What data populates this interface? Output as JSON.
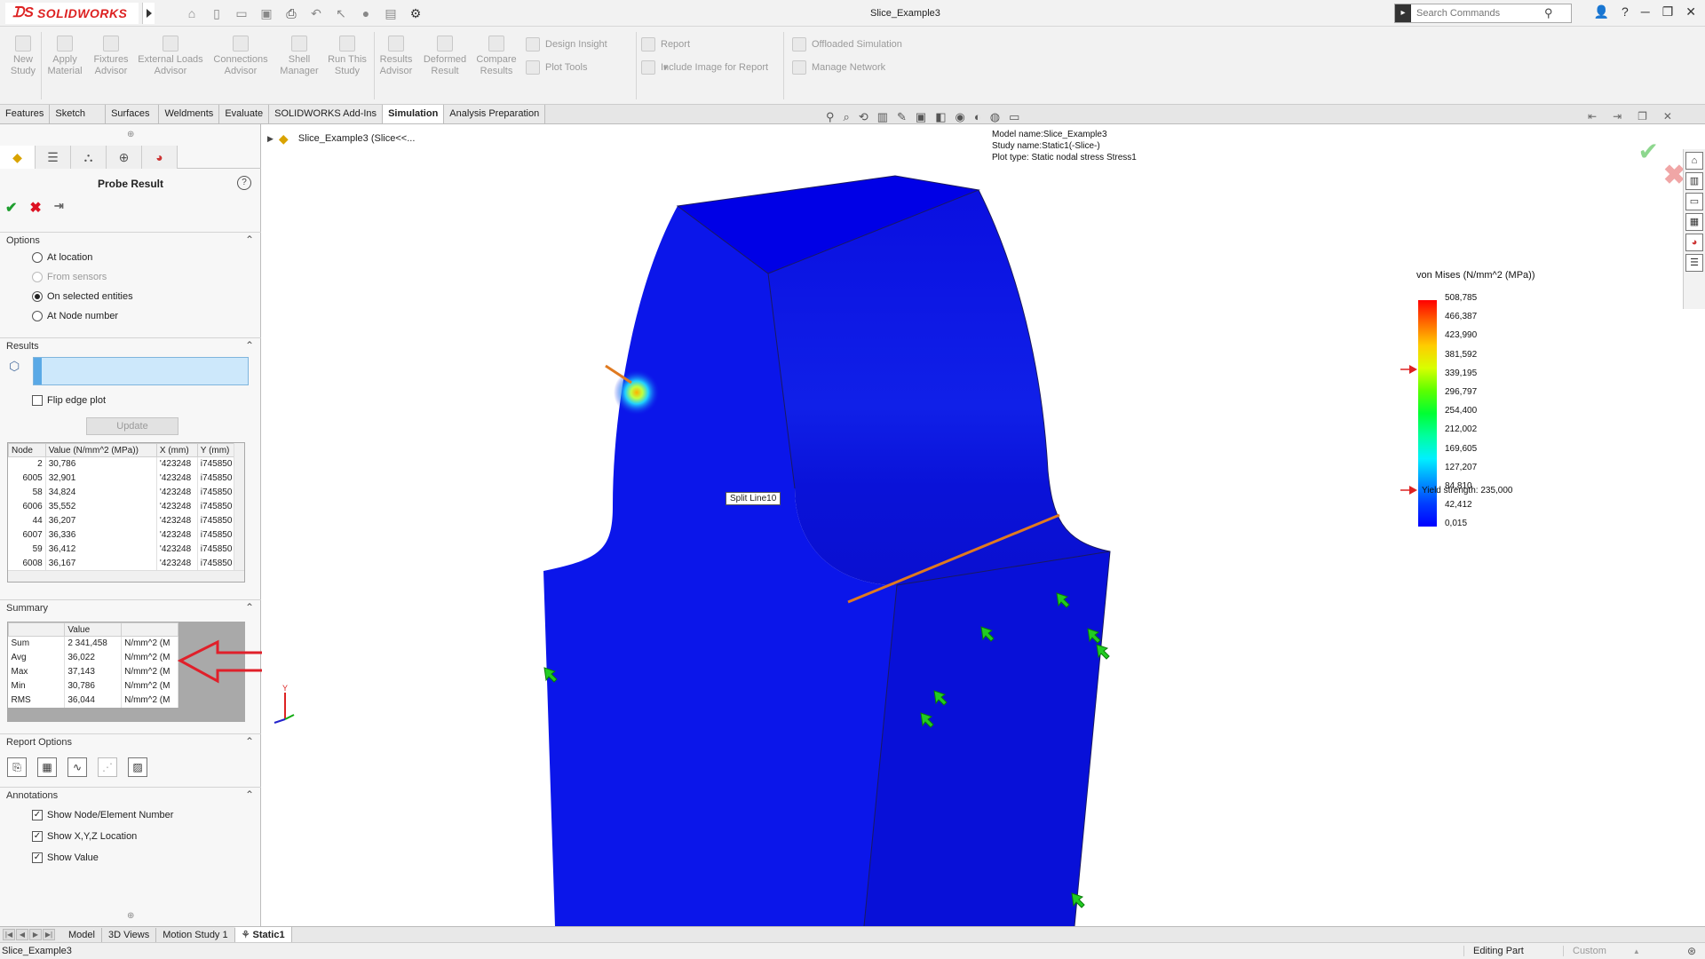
{
  "app": {
    "brand": "SOLIDWORKS",
    "doc_title": "Slice_Example3",
    "search_placeholder": "Search Commands"
  },
  "command_manager": {
    "large": [
      {
        "label": "New\nStudy"
      },
      {
        "label": "Apply\nMaterial"
      },
      {
        "label": "Fixtures\nAdvisor"
      },
      {
        "label": "External Loads\nAdvisor"
      },
      {
        "label": "Connections\nAdvisor"
      },
      {
        "label": "Shell\nManager"
      },
      {
        "label": "Run This\nStudy"
      },
      {
        "label": "Results\nAdvisor"
      },
      {
        "label": "Deformed\nResult"
      },
      {
        "label": "Compare\nResults"
      }
    ],
    "small": [
      "Design Insight",
      "Plot Tools",
      "Report",
      "Include Image for Report",
      "Offloaded Simulation",
      "Manage Network"
    ]
  },
  "tabs": [
    "Features",
    "Sketch",
    "Surfaces",
    "Weldments",
    "Evaluate",
    "SOLIDWORKS Add-Ins",
    "Simulation",
    "Analysis Preparation"
  ],
  "active_tab": "Simulation",
  "property_manager": {
    "title": "Probe Result",
    "options": {
      "header": "Options",
      "items": [
        "At location",
        "From sensors",
        "On selected entities",
        "At Node number"
      ],
      "selected": "On selected entities"
    },
    "results": {
      "header": "Results",
      "flip_edge_plot": "Flip edge plot",
      "update": "Update",
      "columns": [
        "Node",
        "Value (N/mm^2 (MPa))",
        "X (mm)",
        "Y (mm)"
      ],
      "rows": [
        [
          "2",
          "30,786",
          "'423248",
          "i745850"
        ],
        [
          "6005",
          "32,901",
          "'423248",
          "i745850"
        ],
        [
          "58",
          "34,824",
          "'423248",
          "i745850"
        ],
        [
          "6006",
          "35,552",
          "'423248",
          "i745850"
        ],
        [
          "44",
          "36,207",
          "'423248",
          "i745850"
        ],
        [
          "6007",
          "36,336",
          "'423248",
          "i745850"
        ],
        [
          "59",
          "36,412",
          "'423248",
          "i745850"
        ],
        [
          "6008",
          "36,167",
          "'423248",
          "i745850"
        ]
      ]
    },
    "summary": {
      "header": "Summary",
      "columns": [
        "",
        "Value",
        ""
      ],
      "rows": [
        [
          "Sum",
          "2 341,458",
          "N/mm^2 (M"
        ],
        [
          "Avg",
          "36,022",
          "N/mm^2 (M"
        ],
        [
          "Max",
          "37,143",
          "N/mm^2 (M"
        ],
        [
          "Min",
          "30,786",
          "N/mm^2 (M"
        ],
        [
          "RMS",
          "36,044",
          "N/mm^2 (M"
        ]
      ]
    },
    "report_options": {
      "header": "Report Options"
    },
    "annotations": {
      "header": "Annotations",
      "items": [
        "Show Node/Element Number",
        "Show X,Y,Z Location",
        "Show Value"
      ]
    }
  },
  "graphics": {
    "tree_label": "Slice_Example3  (Slice<<...",
    "model_info": [
      "Model name:Slice_Example3",
      "Study name:Static1(-Slice-)",
      "Plot type: Static nodal stress Stress1"
    ],
    "split_line_label": "Split Line10",
    "legend": {
      "title": "von Mises (N/mm^2 (MPa))",
      "values": [
        "508,785",
        "466,387",
        "423,990",
        "381,592",
        "339,195",
        "296,797",
        "254,400",
        "212,002",
        "169,605",
        "127,207",
        "84,810",
        "42,412",
        "0,015"
      ],
      "yield_text": "Yield strength: 235,000",
      "yield_value": 235.0,
      "max": 508.785,
      "min": 0.015
    }
  },
  "bottom_tabs": [
    "Model",
    "3D Views",
    "Motion Study 1",
    "Static1"
  ],
  "active_bottom_tab": "Static1",
  "status": {
    "left": "Slice_Example3",
    "editing": "Editing Part",
    "custom": "Custom"
  },
  "colors": {
    "brand_red": "#d22222",
    "ok_green": "#1e9e2e",
    "cancel_red": "#dd1122",
    "part_blue": "#0a14e6",
    "annotation_red": "#e0202a"
  }
}
